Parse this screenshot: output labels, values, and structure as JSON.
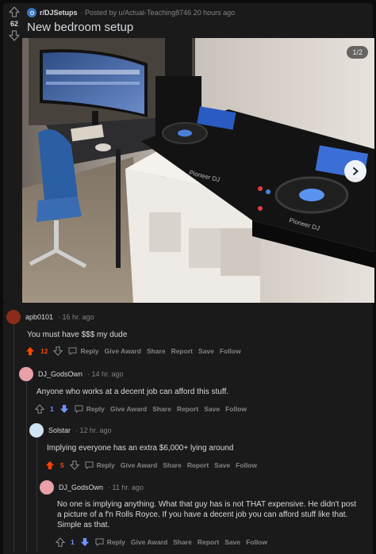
{
  "post": {
    "score": "62",
    "subreddit": "r/DJSetups",
    "posted_by": "· Posted by u/Actual-Teaching8746 20 hours ago",
    "title": "New bedroom setup",
    "gallery_counter": "1/2",
    "photo_branding": [
      "Pioneer DJ",
      "Pioneer DJ"
    ]
  },
  "comments": [
    {
      "author": "apb0101",
      "time": "· 16 hr. ago",
      "body": "You must have $$$ my dude",
      "votes": "12",
      "vote_state": "up",
      "avatar_color": "#8b2c1b"
    },
    {
      "author": "DJ_GodsOwn",
      "time": "· 14 hr. ago",
      "body": "Anyone who works at a decent job can afford this stuff.",
      "votes": "1",
      "vote_state": "down",
      "avatar_color": "#e9a0a8"
    },
    {
      "author": "Solstar",
      "time": "· 12 hr. ago",
      "body": "Implying everyone has an extra $6,000+ lying around",
      "votes": "5",
      "vote_state": "up",
      "avatar_color": "#cfe3f5"
    },
    {
      "author": "DJ_GodsOwn",
      "time": "· 11 hr. ago",
      "body": "No one is implying anything. What that guy has is not THAT expensive. He didn't post a picture of a f'n Rolls Royce. If you have a decent job you can afford stuff like that. Simple as that.",
      "votes": "1",
      "vote_state": "down",
      "avatar_color": "#e9a0a8"
    }
  ],
  "actions": {
    "reply": "Reply",
    "give_award": "Give Award",
    "share": "Share",
    "report": "Report",
    "save": "Save",
    "follow": "Follow"
  },
  "colors": {
    "upvote": "#ff4500",
    "downvote": "#7193ff",
    "muted": "#818384",
    "card": "#1a1a1b",
    "subreddit_icon": "#3b74c4"
  }
}
